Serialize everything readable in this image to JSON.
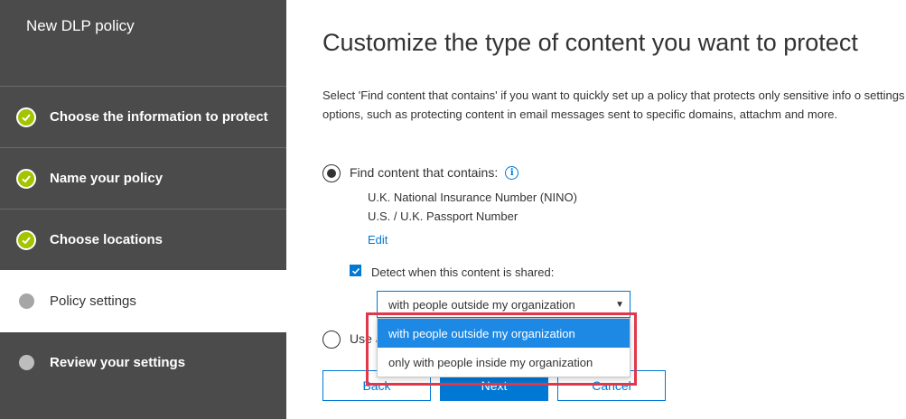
{
  "sidebar": {
    "title": "New DLP policy",
    "steps": [
      {
        "label": "Choose the information to protect",
        "status": "complete"
      },
      {
        "label": "Name your policy",
        "status": "complete"
      },
      {
        "label": "Choose locations",
        "status": "complete"
      },
      {
        "label": "Policy settings",
        "status": "current"
      },
      {
        "label": "Review your settings",
        "status": "pending"
      }
    ]
  },
  "main": {
    "title": "Customize the type of content you want to protect",
    "description": "Select 'Find content that contains' if you want to quickly set up a policy that protects only sensitive info o settings for more options, such as protecting content in email messages sent to specific domains, attachm and more.",
    "find_option": {
      "label": "Find content that contains:",
      "selected": true,
      "info_types": [
        "U.K. National Insurance Number (NINO)",
        "U.S. / U.K. Passport Number"
      ],
      "edit_label": "Edit"
    },
    "detect_shared": {
      "label": "Detect when this content is shared:",
      "checked": true,
      "selected_value": "with people outside my organization",
      "options": [
        "with people outside my organization",
        "only with people inside my organization"
      ]
    },
    "advanced_option": {
      "label": "Use a",
      "selected": false
    },
    "buttons": {
      "back": "Back",
      "next": "Next",
      "cancel": "Cancel"
    }
  },
  "colors": {
    "sidebar_bg": "#4b4b4b",
    "check_green": "#a4c400",
    "accent_blue": "#0078d4",
    "option_highlight": "#1e88e5",
    "annotation_red": "#e0384a"
  }
}
